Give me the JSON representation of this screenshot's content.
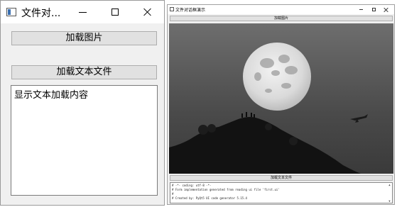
{
  "window_small": {
    "title": "文件对...",
    "load_image_label": "加载图片",
    "load_text_label": "加载文本文件",
    "text_content": "显示文本加载内容"
  },
  "window_large": {
    "title": "文件对话框演示",
    "load_image_label": "加载图片",
    "load_text_label": "加载文本文件",
    "code_lines": [
      "# -*- coding: utf-8 -*-",
      "",
      "# Form implementation generated from reading ui file 'first.ui'",
      "#",
      "# Created by: PyQt5 UI code generator 5.15.4"
    ],
    "image": "moon-over-hill-photo"
  },
  "colors": {
    "button_bg": "#e1e1e1",
    "window_bg": "#f0f0f0",
    "titlebar_bg": "#ffffff"
  }
}
